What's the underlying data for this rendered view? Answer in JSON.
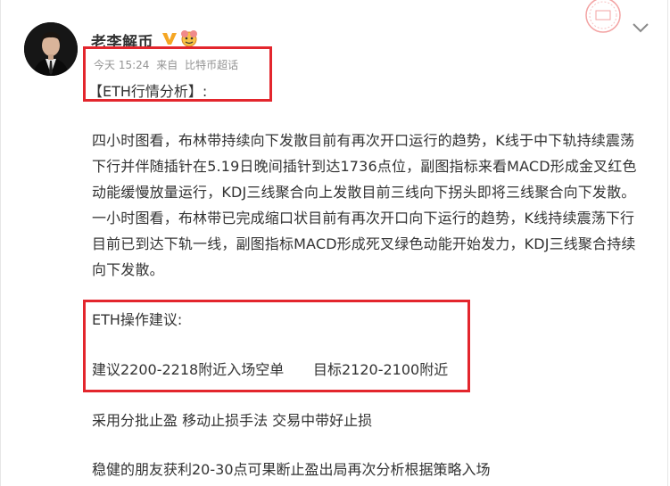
{
  "post": {
    "author": "老李解币",
    "time": "今天 15:24",
    "via": "来自",
    "source": "比特币超话",
    "title": "【ETH行情分析】:",
    "analysis": "四小时图看，布林带持续向下发散目前有再次开口运行的趋势，K线于中下轨持续震荡下行并伴随插针在5.19日晚间插针到达1736点位，副图指标来看MACD形成金叉红色动能缓慢放量运行，KDJ三线聚合向上发散目前三线向下拐头即将三线聚合向下发散。一小时图看，布林带已完成缩口状目前有再次开口向下运行的趋势，K线持续震荡下行目前已到达下轨一线，副图指标MACD形成死叉绿色动能开始发力，KDJ三线聚合持续向下发散。",
    "advice_title": "ETH操作建议:",
    "advice_entry": "建议2200-2218附近入场空单",
    "advice_target": "目标2120-2100附近",
    "stop_method": "采用分批止盈 移动止损手法 交易中带好止损",
    "steady_note": "稳健的朋友获利20-30点可果断止盈出局再次分析根据策略入场"
  },
  "icons": {
    "avatar": "avatar-photo",
    "verified": "verified-v-icon",
    "emoji": "emoji-badge-icon",
    "seal": "stamp-seal-icon",
    "menu": "chevron-down-icon"
  },
  "colors": {
    "highlight_box": "#e3262d",
    "text": "#333333",
    "meta_text": "#939393",
    "verified": "#f5a623"
  }
}
